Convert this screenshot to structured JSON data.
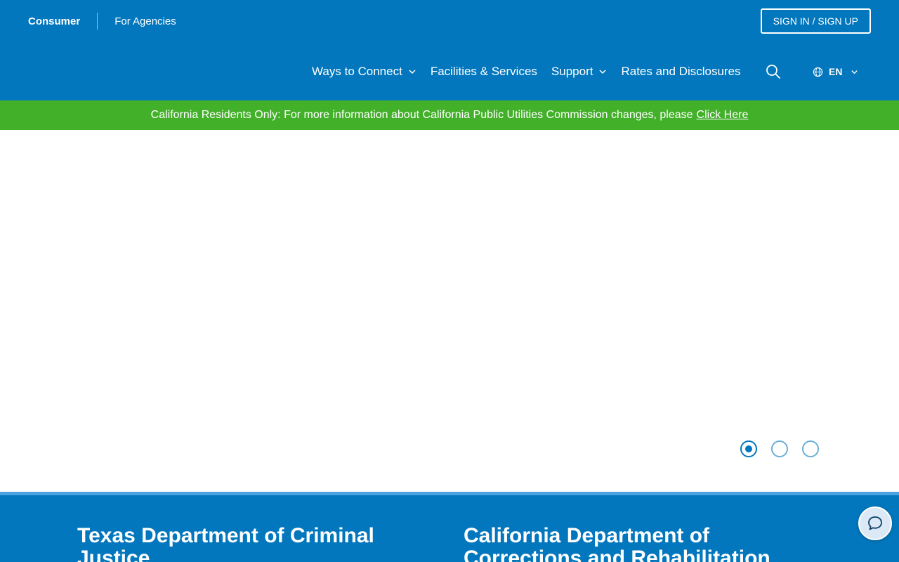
{
  "header": {
    "audience_consumer": "Consumer",
    "audience_agencies": "For Agencies",
    "signin_label": "SIGN IN / SIGN UP",
    "nav": {
      "ways_to_connect": "Ways to Connect",
      "facilities_services": "Facilities & Services",
      "support": "Support",
      "rates_disclosures": "Rates and Disclosures"
    },
    "language": "EN"
  },
  "banner": {
    "text": "California Residents Only: For more information about California Public Utilities Commission changes, please",
    "link": "Click Here"
  },
  "carousel": {
    "slide_count": 3,
    "active_index": 0
  },
  "facilities": {
    "first": "Texas Department of Criminal Justice",
    "second": "California Department of Corrections and Rehabilitation"
  },
  "colors": {
    "brand_blue": "#0277bd",
    "banner_green": "#43b02a"
  },
  "icons": {
    "search": "search-icon",
    "globe": "globe-icon",
    "chevron": "chevron-down-icon",
    "chat": "chat-bubble-icon"
  }
}
